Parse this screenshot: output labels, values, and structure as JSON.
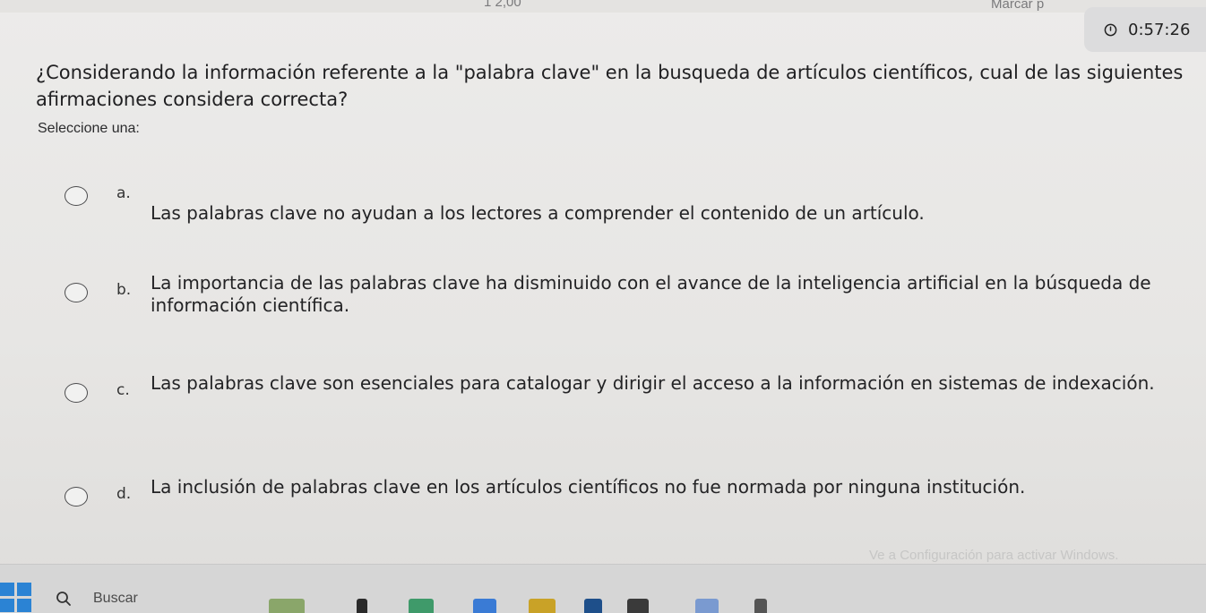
{
  "header": {
    "partial_grade": "1 2,00",
    "partial_mark": "Marcar p",
    "timer": "0:57:26"
  },
  "question": {
    "text": "¿Considerando la información referente a la \"palabra clave\" en la busqueda de artículos científicos, cual de las siguientes afirmaciones considera correcta?",
    "instruction": "Seleccione una:"
  },
  "options": [
    {
      "letter": "a.",
      "text": "Las palabras clave no ayudan a los lectores a comprender el contenido de un artículo."
    },
    {
      "letter": "b.",
      "text": "La importancia de las palabras clave ha disminuido con el avance de la inteligencia artificial en la búsqueda de información científica."
    },
    {
      "letter": "c.",
      "text": "Las palabras clave son esenciales para catalogar y dirigir el acceso a la información en sistemas de indexación."
    },
    {
      "letter": "d.",
      "text": "La inclusión de palabras clave en los artículos científicos no fue normada por ninguna institución."
    }
  ],
  "watermark": "Ve a Configuración para activar Windows.",
  "taskbar": {
    "search_label": "Buscar",
    "colors": {
      "start": "#2b83d4",
      "app1": "#6a9a3a",
      "app2": "#3a7bd5",
      "app3": "#c9a227",
      "app4": "#1e4f8a"
    }
  }
}
